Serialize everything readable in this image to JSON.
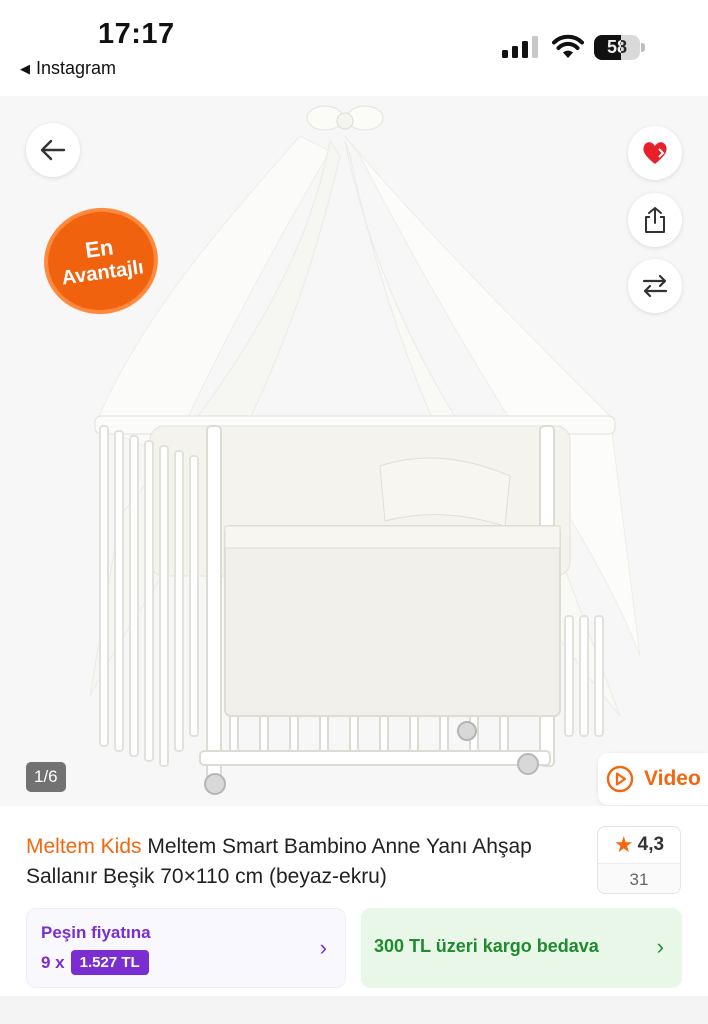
{
  "status_bar": {
    "time": "17:17",
    "back_app": "Instagram",
    "battery_level": "58",
    "battery_fraction": 0.58
  },
  "image": {
    "badge_line1": "En",
    "badge_line2": "Avantajlı",
    "counter": "1/6",
    "video_label": "Video"
  },
  "icons": {
    "back": "arrow-left-icon",
    "favorite": "heart-icon",
    "share": "share-icon",
    "compare": "swap-arrows-icon",
    "video": "play-circle-icon",
    "star": "star-icon"
  },
  "product": {
    "brand": "Meltem Kids",
    "name": " Meltem Smart Bambino Anne Yanı Ahşap Sallanır Beşik 70×110 cm (beyaz-ekru)",
    "rating": "4,3",
    "review_count": "31"
  },
  "installment": {
    "label": "Peşin fiyatına",
    "count": "9 x",
    "price": "1.527 TL"
  },
  "shipping": {
    "label": "300 TL üzeri kargo bedava"
  },
  "colors": {
    "accent_orange": "#f2670f",
    "installment_purple": "#7a2ed1",
    "shipping_green": "#1f8a2e",
    "favorite_red": "#e8202a"
  }
}
